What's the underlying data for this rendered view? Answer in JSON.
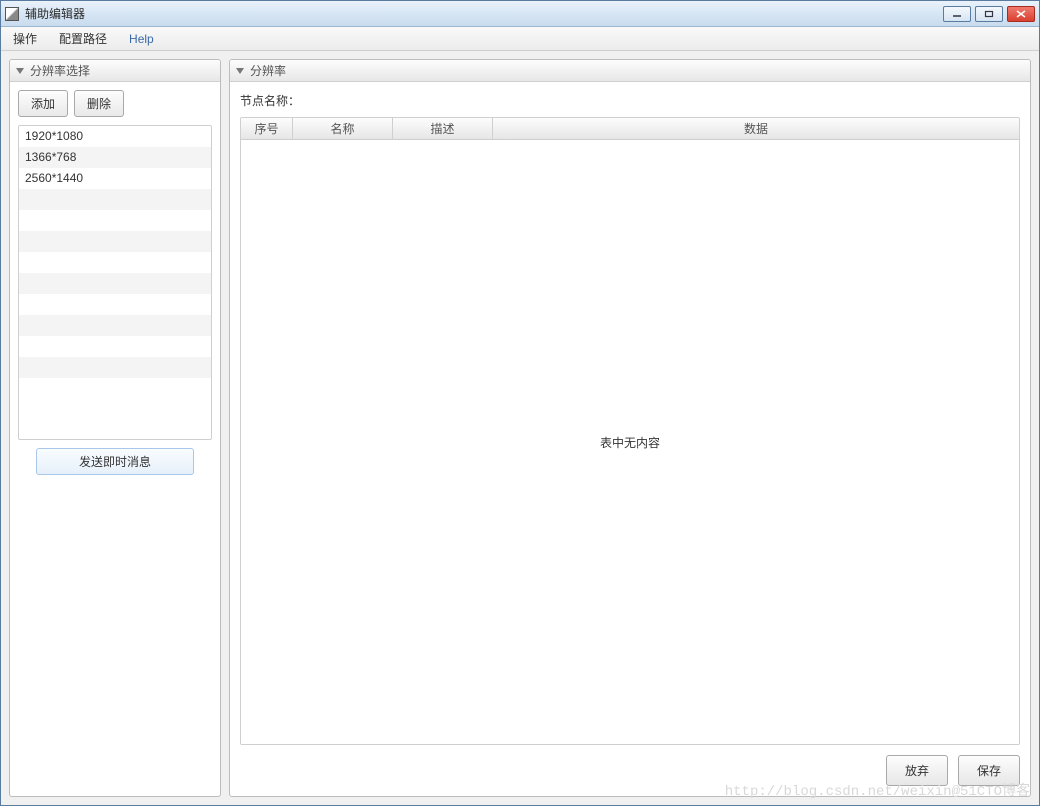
{
  "window": {
    "title": "辅助编辑器"
  },
  "menubar": {
    "items": [
      "操作",
      "配置路径",
      "Help"
    ]
  },
  "left": {
    "header": "分辨率选择",
    "add_label": "添加",
    "delete_label": "删除",
    "resolutions": [
      "1920*1080",
      "1366*768",
      "2560*1440"
    ],
    "send_label": "发送即时消息"
  },
  "right": {
    "header": "分辨率",
    "node_label": "节点名称：",
    "columns": [
      "序号",
      "名称",
      "描述",
      "数据"
    ],
    "empty_text": "表中无内容",
    "discard_label": "放弃",
    "save_label": "保存"
  },
  "watermark": "http://blog.csdn.net/weixin@51CTO博客"
}
